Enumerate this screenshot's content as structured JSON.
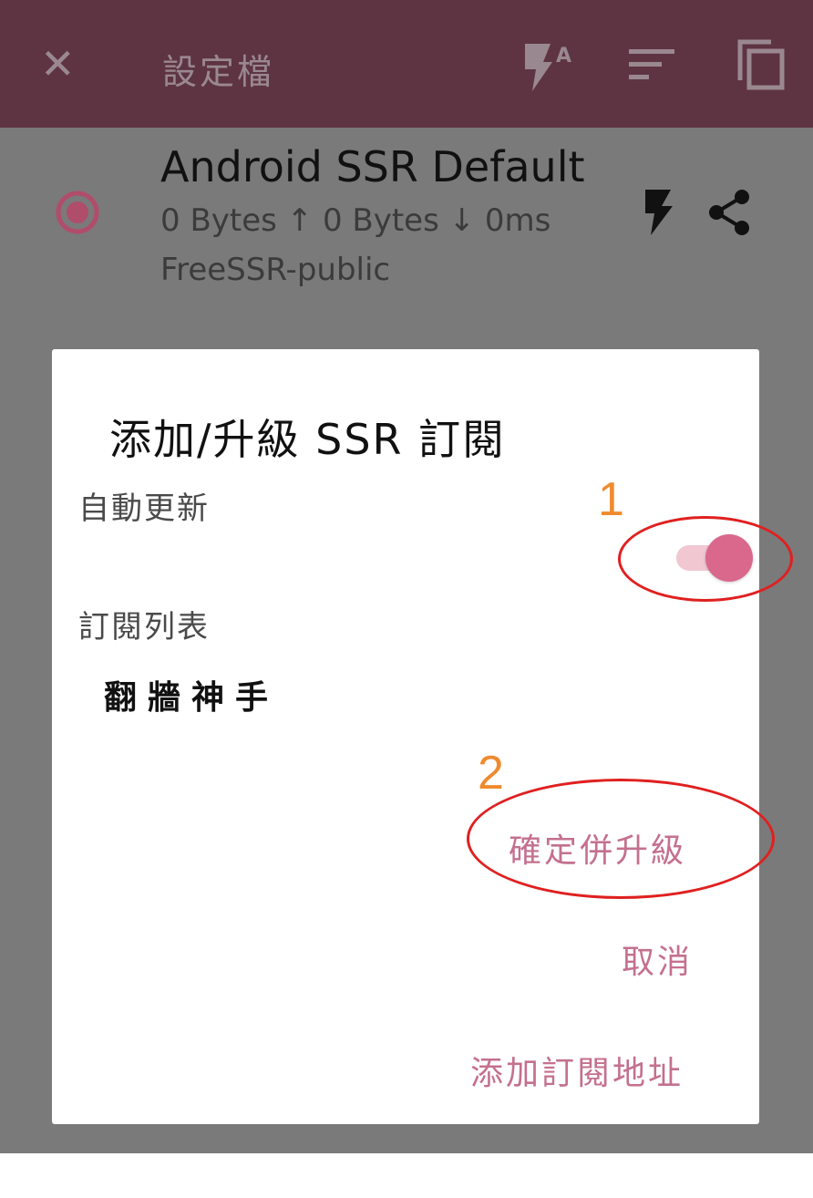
{
  "toolbar": {
    "title": "設定檔",
    "icons": [
      "close-icon",
      "flash-auto-icon",
      "sort-icon",
      "copy-icon"
    ]
  },
  "profile": {
    "name": "Android SSR Default",
    "stats": "0 Bytes ↑  0 Bytes ↓  0ms",
    "group": "FreeSSR-public",
    "selected": true
  },
  "dialog": {
    "title": "添加/升級 SSR 訂閱",
    "auto_update_label": "自動更新",
    "auto_update_enabled": true,
    "subscription_list_label": "訂閱列表",
    "subscriptions": [
      "翻牆神手"
    ],
    "actions": {
      "confirm": "確定併升級",
      "cancel": "取消",
      "add": "添加訂閱地址"
    }
  },
  "annotations": {
    "marker_1": "1",
    "marker_2": "2"
  },
  "colors": {
    "toolbar": "#5e3442",
    "accent": "#d9688c",
    "action_text": "#c4708e",
    "annotation_number": "#f08a2e",
    "annotation_ring": "#e02020"
  }
}
